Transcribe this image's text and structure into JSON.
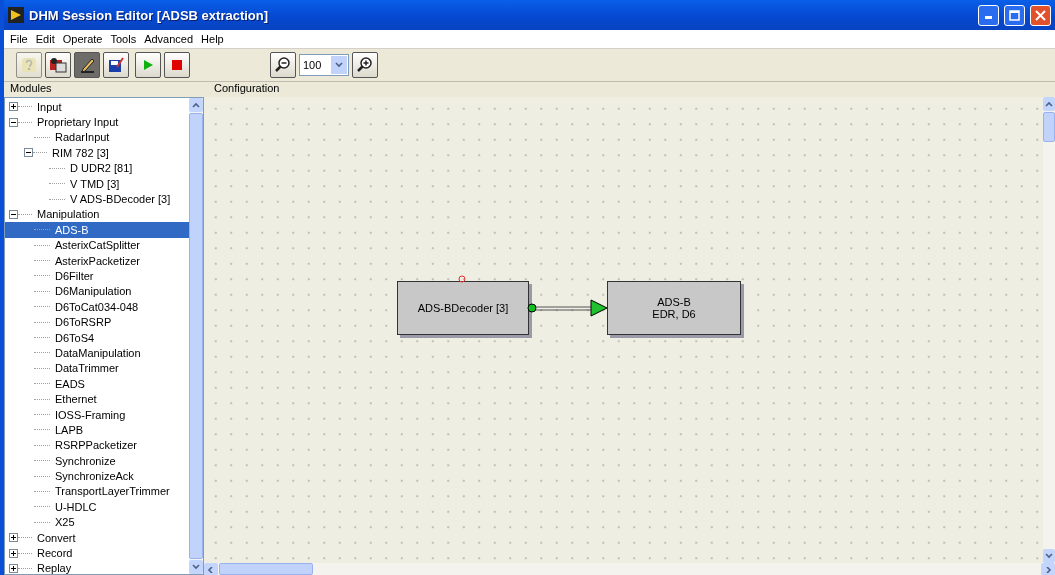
{
  "window": {
    "title": "DHM Session Editor [ADSB extraction]"
  },
  "menu": [
    "File",
    "Edit",
    "Operate",
    "Tools",
    "Advanced",
    "Help"
  ],
  "toolbar": [
    {
      "kind": "help",
      "disabled": true,
      "pressed": false
    },
    {
      "kind": "camera",
      "disabled": false,
      "pressed": false
    },
    {
      "kind": "edit",
      "disabled": false,
      "pressed": true
    },
    {
      "kind": "save",
      "disabled": false,
      "pressed": false
    },
    {
      "kind": "run",
      "disabled": false,
      "pressed": false
    },
    {
      "kind": "stop",
      "disabled": false,
      "pressed": false
    }
  ],
  "zoom": {
    "value": "100"
  },
  "modules": {
    "title": "Modules",
    "items": [
      {
        "label": "Input",
        "expanded": false,
        "selected": false
      },
      {
        "label": "Proprietary Input",
        "expanded": true,
        "selected": false,
        "children": [
          {
            "label": "RadarInput",
            "selected": false
          },
          {
            "label": "RIM 782 [3]",
            "expanded": true,
            "selected": false,
            "children": [
              {
                "label": "D UDR2 [81]",
                "selected": false
              },
              {
                "label": "V TMD [3]",
                "selected": false
              },
              {
                "label": "V ADS-BDecoder [3]",
                "selected": false
              }
            ]
          }
        ]
      },
      {
        "label": "Manipulation",
        "expanded": true,
        "selected": false,
        "children": [
          {
            "label": "ADS-B",
            "selected": true
          },
          {
            "label": "AsterixCatSplitter",
            "selected": false
          },
          {
            "label": "AsterixPacketizer",
            "selected": false
          },
          {
            "label": "D6Filter",
            "selected": false
          },
          {
            "label": "D6Manipulation",
            "selected": false
          },
          {
            "label": "D6ToCat034-048",
            "selected": false
          },
          {
            "label": "D6ToRSRP",
            "selected": false
          },
          {
            "label": "D6ToS4",
            "selected": false
          },
          {
            "label": "DataManipulation",
            "selected": false
          },
          {
            "label": "DataTrimmer",
            "selected": false
          },
          {
            "label": "EADS",
            "selected": false
          },
          {
            "label": "Ethernet",
            "selected": false
          },
          {
            "label": "IOSS-Framing",
            "selected": false
          },
          {
            "label": "LAPB",
            "selected": false
          },
          {
            "label": "RSRPPacketizer",
            "selected": false
          },
          {
            "label": "Synchronize",
            "selected": false
          },
          {
            "label": "SynchronizeAck",
            "selected": false
          },
          {
            "label": "TransportLayerTrimmer",
            "selected": false
          },
          {
            "label": "U-HDLC",
            "selected": false
          },
          {
            "label": "X25",
            "selected": false
          }
        ]
      },
      {
        "label": "Convert",
        "expanded": false,
        "selected": false
      },
      {
        "label": "Record",
        "expanded": false,
        "selected": false
      },
      {
        "label": "Replay",
        "expanded": false,
        "selected": false
      }
    ]
  },
  "configuration": {
    "title": "Configuration",
    "nodes": [
      {
        "lines": [
          "ADS-BDecoder [3]"
        ],
        "selected": false
      },
      {
        "lines": [
          "ADS-B",
          "EDR, D6"
        ],
        "selected": false
      }
    ]
  }
}
